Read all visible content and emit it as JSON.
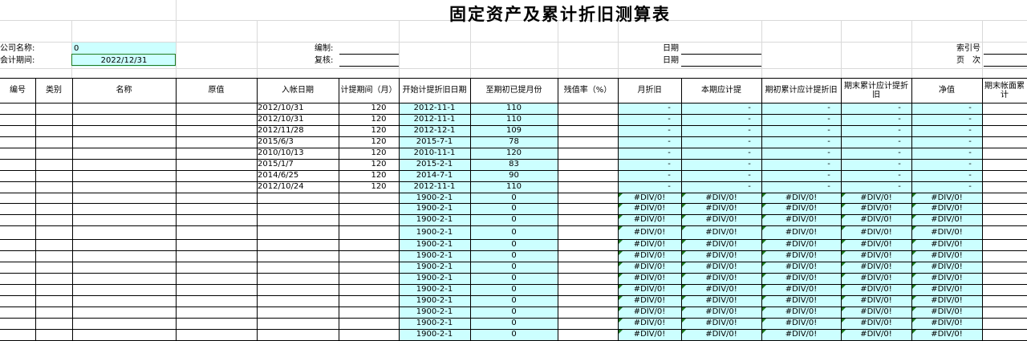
{
  "title": "固定资产及累计折旧测算表",
  "info": {
    "company_label": "公司名称:",
    "company_value": "0",
    "period_label": "会计期间:",
    "period_value": "2022/12/31",
    "prepared_by_label": "编制:",
    "reviewed_by_label": "复核:",
    "date_label_1": "日期",
    "date_label_2": "日期",
    "index_label": "索引号",
    "page_label": "页　次"
  },
  "columns": [
    "编号",
    "类别",
    "名称",
    "原值",
    "入帐日期",
    "计提期间（月）",
    "开始计提折旧日期",
    "至期初已提月份",
    "残值率（%）",
    "月折旧",
    "本期应计提",
    "期初累计应计提折旧",
    "期末累计应计提折旧",
    "净值",
    "期末帐面累计"
  ],
  "rows": [
    {
      "entry_date": "2012/10/31",
      "period": "120",
      "start_date": "2012-11-1",
      "months": "110",
      "values": [
        "-",
        "-",
        "-",
        "-",
        "-"
      ]
    },
    {
      "entry_date": "2012/10/31",
      "period": "120",
      "start_date": "2012-11-1",
      "months": "110",
      "values": [
        "-",
        "-",
        "-",
        "-",
        "-"
      ]
    },
    {
      "entry_date": "2012/11/28",
      "period": "120",
      "start_date": "2012-12-1",
      "months": "109",
      "values": [
        "-",
        "-",
        "-",
        "-",
        "-"
      ]
    },
    {
      "entry_date": "2015/6/3",
      "period": "120",
      "start_date": "2015-7-1",
      "months": "78",
      "values": [
        "-",
        "-",
        "-",
        "-",
        "-"
      ]
    },
    {
      "entry_date": "2010/10/13",
      "period": "120",
      "start_date": "2010-11-1",
      "months": "120",
      "values": [
        "-",
        "-",
        "-",
        "-",
        "-"
      ]
    },
    {
      "entry_date": "2015/1/7",
      "period": "120",
      "start_date": "2015-2-1",
      "months": "83",
      "values": [
        "-",
        "-",
        "-",
        "-",
        "-"
      ]
    },
    {
      "entry_date": "2014/6/25",
      "period": "120",
      "start_date": "2014-7-1",
      "months": "90",
      "values": [
        "-",
        "-",
        "-",
        "-",
        "-"
      ]
    },
    {
      "entry_date": "2012/10/24",
      "period": "120",
      "start_date": "2012-11-1",
      "months": "110",
      "values": [
        "-",
        "-",
        "-",
        "-",
        "-"
      ]
    },
    {
      "entry_date": "",
      "period": "",
      "start_date": "1900-2-1",
      "months": "0",
      "values": [
        "#DIV/0!",
        "#DIV/0!",
        "#DIV/0!",
        "#DIV/0!",
        "#DIV/0!"
      ]
    },
    {
      "entry_date": "",
      "period": "",
      "start_date": "1900-2-1",
      "months": "0",
      "values": [
        "#DIV/0!",
        "#DIV/0!",
        "#DIV/0!",
        "#DIV/0!",
        "#DIV/0!"
      ]
    },
    {
      "entry_date": "",
      "period": "",
      "start_date": "1900-2-1",
      "months": "0",
      "values": [
        "#DIV/0!",
        "#DIV/0!",
        "#DIV/0!",
        "#DIV/0!",
        "#DIV/0!"
      ]
    },
    {
      "entry_date": "",
      "period": "",
      "start_date": "1900-2-1",
      "months": "0",
      "values": [
        "#DIV/0!",
        "#DIV/0!",
        "#DIV/0!",
        "#DIV/0!",
        "#DIV/0!"
      ]
    },
    {
      "entry_date": "",
      "period": "",
      "start_date": "1900-2-1",
      "months": "0",
      "values": [
        "#DIV/0!",
        "#DIV/0!",
        "#DIV/0!",
        "#DIV/0!",
        "#DIV/0!"
      ]
    },
    {
      "entry_date": "",
      "period": "",
      "start_date": "1900-2-1",
      "months": "0",
      "values": [
        "#DIV/0!",
        "#DIV/0!",
        "#DIV/0!",
        "#DIV/0!",
        "#DIV/0!"
      ]
    },
    {
      "entry_date": "",
      "period": "",
      "start_date": "1900-2-1",
      "months": "0",
      "values": [
        "#DIV/0!",
        "#DIV/0!",
        "#DIV/0!",
        "#DIV/0!",
        "#DIV/0!"
      ]
    },
    {
      "entry_date": "",
      "period": "",
      "start_date": "1900-2-1",
      "months": "0",
      "values": [
        "#DIV/0!",
        "#DIV/0!",
        "#DIV/0!",
        "#DIV/0!",
        "#DIV/0!"
      ]
    },
    {
      "entry_date": "",
      "period": "",
      "start_date": "1900-2-1",
      "months": "0",
      "values": [
        "#DIV/0!",
        "#DIV/0!",
        "#DIV/0!",
        "#DIV/0!",
        "#DIV/0!"
      ]
    },
    {
      "entry_date": "",
      "period": "",
      "start_date": "1900-2-1",
      "months": "0",
      "values": [
        "#DIV/0!",
        "#DIV/0!",
        "#DIV/0!",
        "#DIV/0!",
        "#DIV/0!"
      ]
    },
    {
      "entry_date": "",
      "period": "",
      "start_date": "1900-2-1",
      "months": "0",
      "values": [
        "#DIV/0!",
        "#DIV/0!",
        "#DIV/0!",
        "#DIV/0!",
        "#DIV/0!"
      ]
    },
    {
      "entry_date": "",
      "period": "",
      "start_date": "1900-2-1",
      "months": "0",
      "values": [
        "#DIV/0!",
        "#DIV/0!",
        "#DIV/0!",
        "#DIV/0!",
        "#DIV/0!"
      ]
    },
    {
      "entry_date": "",
      "period": "",
      "start_date": "1900-2-1",
      "months": "0",
      "values": [
        "#DIV/0!",
        "#DIV/0!",
        "#DIV/0!",
        "#DIV/0!",
        "#DIV/0!"
      ]
    }
  ],
  "colors": {
    "highlight": "#ccffff",
    "error_marker": "#1f7a1f",
    "grid": "#d9d9d9"
  }
}
